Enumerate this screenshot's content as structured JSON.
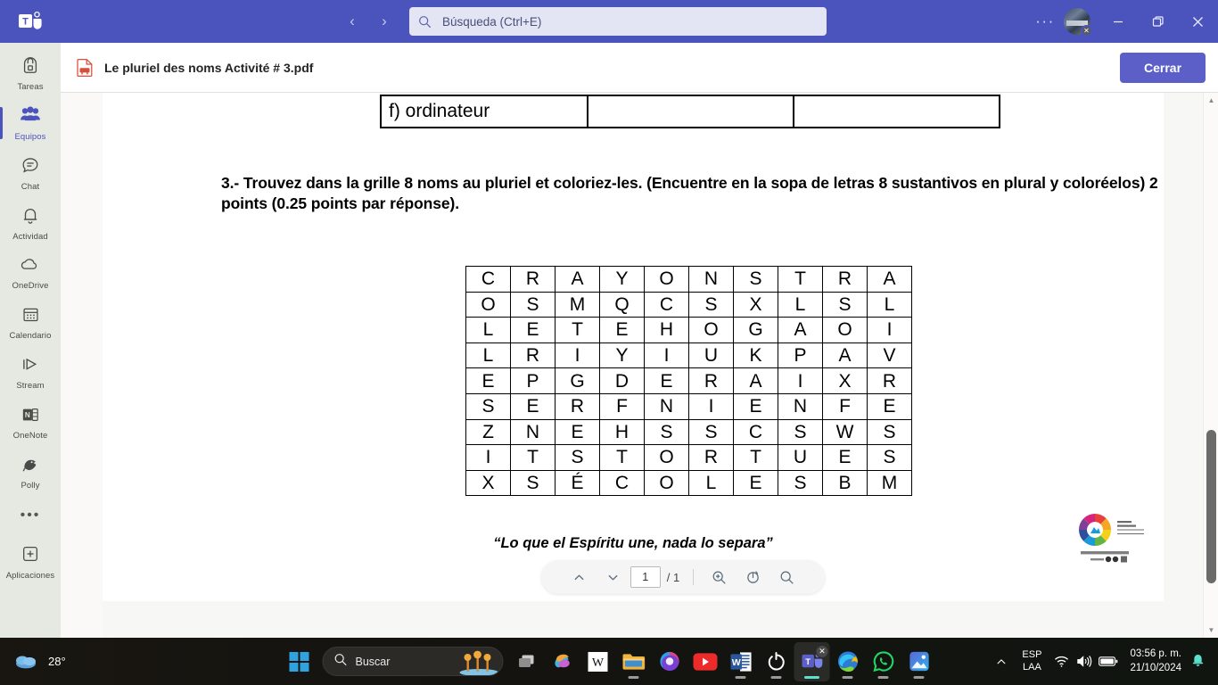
{
  "titlebar": {
    "app_logo": "teams-logo",
    "back_label": "‹",
    "forward_label": "›",
    "search": {
      "placeholder": "Búsqueda (Ctrl+E)",
      "value": ""
    },
    "more_label": "···",
    "minimize_label": "—",
    "maximize_label": "maximize",
    "close_label": "✕",
    "accent_color": "#4b53bc"
  },
  "rail": {
    "items": [
      {
        "label": "Tareas",
        "icon": "backpack-icon",
        "active": false
      },
      {
        "label": "Equipos",
        "icon": "people-icon",
        "active": true
      },
      {
        "label": "Chat",
        "icon": "chat-icon",
        "active": false
      },
      {
        "label": "Actividad",
        "icon": "bell-icon",
        "active": false
      },
      {
        "label": "OneDrive",
        "icon": "cloud-icon",
        "active": false
      },
      {
        "label": "Calendario",
        "icon": "calendar-icon",
        "active": false
      },
      {
        "label": "Stream",
        "icon": "stream-icon",
        "active": false
      },
      {
        "label": "OneNote",
        "icon": "onenote-icon",
        "active": false
      },
      {
        "label": "Polly",
        "icon": "polly-icon",
        "active": false
      }
    ],
    "more_label": "•••",
    "apps": {
      "label": "Aplicaciones",
      "icon": "plus-box-icon"
    }
  },
  "filebar": {
    "icon": "pdf-file-icon",
    "filename": "Le pluriel des noms Activité # 3.pdf",
    "close_button": "Cerrar"
  },
  "document": {
    "table_fragment_row": "",
    "table_row_label": "f) ordinateur",
    "question": "3.- Trouvez dans la grille 8 noms au pluriel et  coloriez-les. (Encuentre en la sopa de letras 8 sustantivos en plural y coloréelos)  2 points (0.25 points par réponse).",
    "quote": "“Lo que el Espíritu une, nada lo separa”",
    "logo_name": "school-circular-logo",
    "word_search": {
      "rows": 9,
      "cols": 10,
      "grid": [
        [
          "C",
          "R",
          "A",
          "Y",
          "O",
          "N",
          "S",
          "T",
          "R",
          "A"
        ],
        [
          "O",
          "S",
          "M",
          "Q",
          "C",
          "S",
          "X",
          "L",
          "S",
          "L"
        ],
        [
          "L",
          "E",
          "T",
          "E",
          "H",
          "O",
          "G",
          "A",
          "O",
          "I"
        ],
        [
          "L",
          "R",
          "I",
          "Y",
          "I",
          "U",
          "K",
          "P",
          "A",
          "V"
        ],
        [
          "E",
          "P",
          "G",
          "D",
          "E",
          "R",
          "A",
          "I",
          "X",
          "R"
        ],
        [
          "S",
          "E",
          "R",
          "F",
          "N",
          "I",
          "E",
          "N",
          "F",
          "E"
        ],
        [
          "Z",
          "N",
          "E",
          "H",
          "S",
          "S",
          "C",
          "S",
          "W",
          "S"
        ],
        [
          "I",
          "T",
          "S",
          "T",
          "O",
          "R",
          "T",
          "U",
          "E",
          "S"
        ],
        [
          "X",
          "S",
          "É",
          "C",
          "O",
          "L",
          "E",
          "S",
          "B",
          "M"
        ]
      ]
    }
  },
  "pdf_toolbar": {
    "prev_page_icon": "chevron-up-icon",
    "next_page_icon": "chevron-down-icon",
    "page_value": "1",
    "page_total": "/ 1",
    "zoom_icon": "zoom-in-icon",
    "rotate_icon": "rotate-icon",
    "find_icon": "search-icon"
  },
  "scrollbar": {
    "up_arrow": "▲",
    "down_arrow": "▼"
  },
  "taskbar": {
    "weather": {
      "temp": "28°",
      "icon": "cloud-weather-icon"
    },
    "start_label": "start-icon",
    "search": {
      "placeholder": "Buscar",
      "value": ""
    },
    "taskview_label": "task-view-icon",
    "apps": [
      {
        "name": "copilot-icon",
        "running": false,
        "active": false
      },
      {
        "name": "wikipedia-icon",
        "running": false,
        "active": false
      },
      {
        "name": "file-explorer-icon",
        "running": true,
        "active": false
      },
      {
        "name": "microsoft365-icon",
        "running": false,
        "active": false
      },
      {
        "name": "youtube-icon",
        "running": false,
        "active": false
      },
      {
        "name": "word-icon",
        "running": true,
        "active": false
      },
      {
        "name": "ring-app-icon",
        "running": true,
        "active": false
      },
      {
        "name": "teams-icon",
        "running": true,
        "active": true,
        "badge": "✕"
      },
      {
        "name": "edge-icon",
        "running": true,
        "active": false
      },
      {
        "name": "whatsapp-icon",
        "running": true,
        "active": false
      },
      {
        "name": "photos-icon",
        "running": true,
        "active": false
      }
    ],
    "tray": {
      "chevron": "^",
      "language_line1": "ESP",
      "language_line2": "LAA",
      "wifi_icon": "wifi-icon",
      "volume_icon": "volume-icon",
      "battery_icon": "battery-icon",
      "time": "03:56 p. m.",
      "date": "21/10/2024",
      "notification_icon": "bell-icon"
    }
  }
}
